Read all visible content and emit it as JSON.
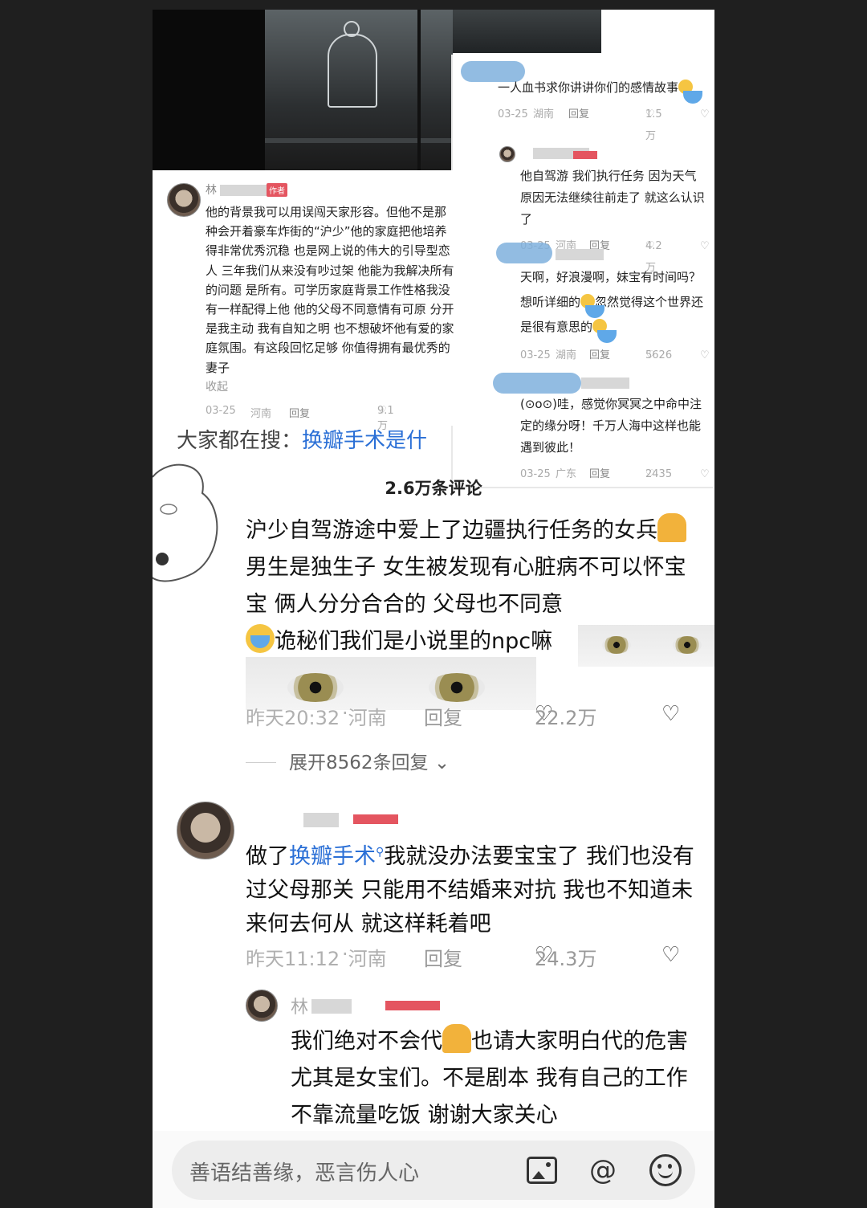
{
  "inset": {
    "c1": {
      "text": "一人血书求你讲讲你们的感情故事",
      "date": "03-25",
      "region": "湖南",
      "reply": "回复",
      "likes": "1.5万"
    },
    "c2": {
      "text": "他自驾游 我们执行任务 因为天气原因无法继续往前走了 就这么认识了",
      "date": "03-25",
      "region": "河南",
      "reply": "回复",
      "likes": "4.2万"
    },
    "c3": {
      "text1": "天啊，好浪漫啊，妹宝有时间吗？想听详细的",
      "text2": "忽然觉得这个世界还是很有意思的",
      "date": "03-25",
      "region": "湖南",
      "reply": "回复",
      "likes": "5626"
    },
    "c4": {
      "text": "(⊙o⊙)哇，感觉你冥冥之中命中注定的缘分呀！千万人海中这样也能遇到彼此！",
      "date": "03-25",
      "region": "广东",
      "reply": "回复",
      "likes": "2435"
    }
  },
  "leftshot": {
    "name_initial": "林",
    "badge": "作者",
    "text": "他的背景我可以用误闯天家形容。但他不是那种会开着豪车炸街的“沪少”他的家庭把他培养得非常优秀沉稳 也是网上说的伟大的引导型恋人 三年我们从来没有吵过架 他能为我解决所有的问题 是所有。可学历家庭背景工作性格我没有一样配得上他 他的父母不同意情有可原 分开是我主动 我有自知之明 也不想破坏他有爱的家庭氛围。有这段回忆足够 你值得拥有最优秀的妻子",
    "collapse": "收起",
    "date": "03-25",
    "region": "河南",
    "reply": "回复",
    "likes": "9.1万"
  },
  "search": {
    "label": "大家都在搜：",
    "query": "换瓣手术是什"
  },
  "comments_count": "2.6万条评论",
  "main_comment": {
    "part1": "沪少自驾游途中爱上了边疆执行任务的女兵",
    "part2": "男生是独生子 女生被发现有心脏病不可以怀宝宝 俩人分分合合的 父母也不同意",
    "part3": "诡秘们我们是小说里的npc嘛",
    "time": "昨天20:32",
    "region": "河南",
    "reply": "回复",
    "likes": "22.2万"
  },
  "expand": "展开8562条回复",
  "comment3": {
    "pre": "做了",
    "link": "换瓣手术",
    "post": "我就没办法要宝宝了 我们也没有过父母那关 只能用不结婚来对抗 我也不知道未来何去何从 就这样耗着吧",
    "time": "昨天11:12",
    "region": "河南",
    "reply": "回复",
    "likes": "24.3万"
  },
  "reply": {
    "name_initial": "林",
    "part1": "我们绝对不会代",
    "part2": "也请大家明白代的危害 尤其是女宝们。不是剧本 我有自己的工作 不靠流量吃饭 谢谢大家关心"
  },
  "input": {
    "placeholder": "善语结善缘，恶言伤人心"
  },
  "icons": [
    "image-icon",
    "at-icon",
    "smile-icon",
    "heart-icon",
    "dislike-icon",
    "search-mini-icon",
    "chevron-down-icon"
  ]
}
